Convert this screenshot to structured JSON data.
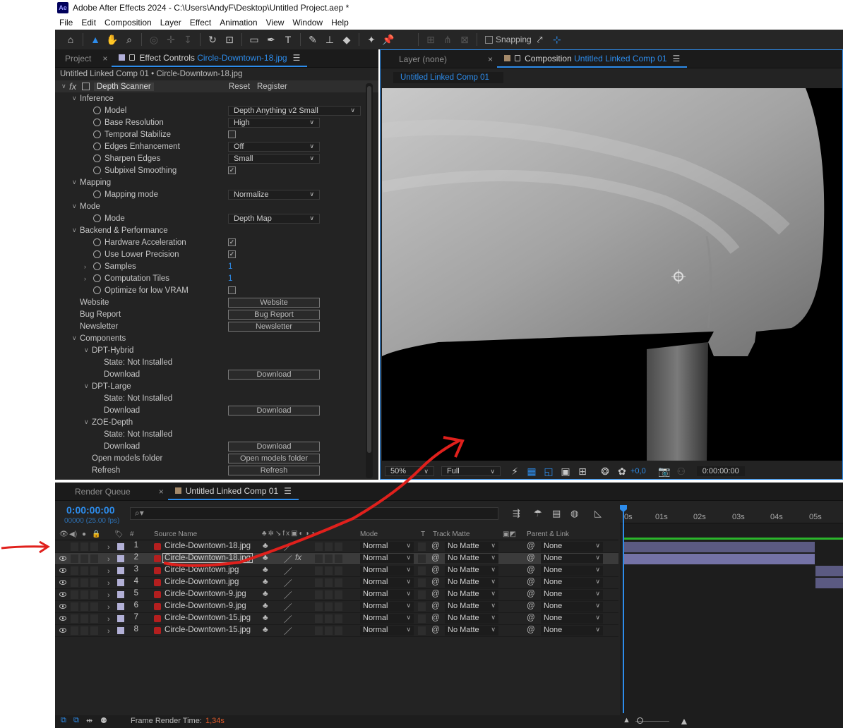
{
  "window": {
    "title": "Adobe After Effects 2024 - C:\\Users\\AndyF\\Desktop\\Untitled Project.aep *",
    "app_badge": "Ae"
  },
  "menu": [
    "File",
    "Edit",
    "Composition",
    "Layer",
    "Effect",
    "Animation",
    "View",
    "Window",
    "Help"
  ],
  "toolbar": {
    "snapping_label": "Snapping"
  },
  "effect_controls": {
    "project_tab": "Project",
    "tab_label": "Effect Controls",
    "tab_target": "Circle-Downtown-18.jpg",
    "subtitle": "Untitled Linked Comp 01 • Circle-Downtown-18.jpg",
    "effect_name": "Depth Scanner",
    "reset": "Reset",
    "register": "Register",
    "groups": {
      "inference": "Inference",
      "mapping": "Mapping",
      "mode": "Mode",
      "backend": "Backend & Performance",
      "components": "Components"
    },
    "props": {
      "model": {
        "label": "Model",
        "value": "Depth Anything v2 Small"
      },
      "base_resolution": {
        "label": "Base Resolution",
        "value": "High"
      },
      "temporal_stabilize": {
        "label": "Temporal Stabilize",
        "checked": false
      },
      "edges_enhancement": {
        "label": "Edges Enhancement",
        "value": "Off"
      },
      "sharpen_edges": {
        "label": "Sharpen Edges",
        "value": "Small"
      },
      "subpixel_smoothing": {
        "label": "Subpixel Smoothing",
        "checked": true
      },
      "mapping_mode": {
        "label": "Mapping mode",
        "value": "Normalize"
      },
      "mode": {
        "label": "Mode",
        "value": "Depth Map"
      },
      "hardware_acceleration": {
        "label": "Hardware Acceleration",
        "checked": true
      },
      "use_lower_precision": {
        "label": "Use Lower Precision",
        "checked": true
      },
      "samples": {
        "label": "Samples",
        "value": "1"
      },
      "computation_tiles": {
        "label": "Computation Tiles",
        "value": "1"
      },
      "optimize_low_vram": {
        "label": "Optimize for low VRAM",
        "checked": false
      }
    },
    "links": {
      "website": {
        "label": "Website",
        "button": "Website"
      },
      "bug_report": {
        "label": "Bug Report",
        "button": "Bug Report"
      },
      "newsletter": {
        "label": "Newsletter",
        "button": "Newsletter"
      }
    },
    "components": [
      {
        "name": "DPT-Hybrid",
        "state": "State: Not Installed",
        "download_label": "Download",
        "download_button": "Download"
      },
      {
        "name": "DPT-Large",
        "state": "State: Not Installed",
        "download_label": "Download",
        "download_button": "Download"
      },
      {
        "name": "ZOE-Depth",
        "state": "State: Not Installed",
        "download_label": "Download",
        "download_button": "Download"
      }
    ],
    "open_models": {
      "label": "Open models folder",
      "button": "Open models folder"
    },
    "refresh": {
      "label": "Refresh",
      "button": "Refresh"
    }
  },
  "composition": {
    "layer_tab": "Layer  (none)",
    "tab_label": "Composition",
    "tab_target": "Untitled Linked Comp 01",
    "breadcrumb": "Untitled Linked Comp 01",
    "zoom": "50%",
    "resolution": "Full",
    "exposure": "+0,0",
    "timecode": "0:00:00:00"
  },
  "timeline": {
    "render_queue_tab": "Render Queue",
    "comp_tab": "Untitled Linked Comp 01",
    "timecode": "0:00:00:00",
    "fps": "00000 (25.00 fps)",
    "search_placeholder": "",
    "columns": {
      "hash": "#",
      "source": "Source Name",
      "mode": "Mode",
      "t": "T",
      "track_matte": "Track Matte",
      "parent": "Parent & Link"
    },
    "ruler": [
      "0s",
      "01s",
      "02s",
      "03s",
      "04s",
      "05s"
    ],
    "layers": [
      {
        "num": "1",
        "name": "Circle-Downtown-18.jpg",
        "mode": "Normal",
        "matte": "No Matte",
        "parent": "None"
      },
      {
        "num": "2",
        "name": "Circle-Downtown-18.jpg",
        "mode": "Normal",
        "matte": "No Matte",
        "parent": "None"
      },
      {
        "num": "3",
        "name": "Circle-Downtown.jpg",
        "mode": "Normal",
        "matte": "No Matte",
        "parent": "None"
      },
      {
        "num": "4",
        "name": "Circle-Downtown.jpg",
        "mode": "Normal",
        "matte": "No Matte",
        "parent": "None"
      },
      {
        "num": "5",
        "name": "Circle-Downtown-9.jpg",
        "mode": "Normal",
        "matte": "No Matte",
        "parent": "None"
      },
      {
        "num": "6",
        "name": "Circle-Downtown-9.jpg",
        "mode": "Normal",
        "matte": "No Matte",
        "parent": "None"
      },
      {
        "num": "7",
        "name": "Circle-Downtown-15.jpg",
        "mode": "Normal",
        "matte": "No Matte",
        "parent": "None"
      },
      {
        "num": "8",
        "name": "Circle-Downtown-15.jpg",
        "mode": "Normal",
        "matte": "No Matte",
        "parent": "None"
      }
    ],
    "frame_render_label": "Frame Render Time:",
    "frame_render_value": "1,34s"
  },
  "colors": {
    "accent": "#2d8ceb",
    "annotation": "#e0201c",
    "label_swatch": "#b0aed8"
  }
}
